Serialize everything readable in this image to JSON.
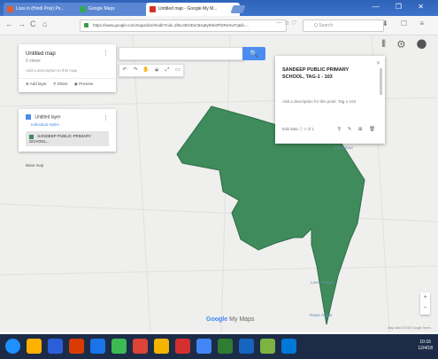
{
  "browser": {
    "tabs": [
      {
        "label": "Loss in (Hindi Poly) Ps...",
        "close": "×",
        "color": "#e25d33"
      },
      {
        "label": "Google Maps",
        "close": "×",
        "color": "#34a853"
      },
      {
        "label": "Untitled map - Google My M...",
        "close": "×",
        "color": "#d93025"
      }
    ],
    "window_controls": "— ❐ ✕",
    "url": "https://www.google.com/maps/d/u/0/edit?mid=1f6sJ4K0Dxr3Hq8y9Xk0Pl2ReXwTq&ll=...",
    "search_placeholder": "Q Search",
    "nav_back": "←",
    "nav_forward": "→",
    "nav_reload": "C",
    "nav_home": "⌂",
    "url_icons": "⋯ ☆ ♡",
    "toolbar_icons": "⬇ ☐ ≡"
  },
  "map": {
    "colors": {
      "polygon": "#3f8b5c",
      "polygon_stroke": "#2f6e48",
      "background": "#efefee",
      "accent": "#4b8cf0"
    },
    "tools": [
      "↶",
      "↷",
      "✋",
      "⬙",
      "⤢",
      "▭"
    ],
    "top_right_icons": "⦀ ⚙ ⬤",
    "search_button": "🔍",
    "labels": [
      {
        "text": "Pandarpur"
      },
      {
        "text": "Laxmi Nagar"
      },
      {
        "text": "Ratan Nagar"
      }
    ],
    "google_logo": "Google",
    "google_suffix": "My Maps",
    "zoom_in": "+",
    "zoom_out": "−",
    "footer": "Map data ©2018 Google  Terms"
  },
  "legend": {
    "title": "Untitled map",
    "views": "0 views",
    "description": "Add a description to this map",
    "actions": [
      "⊕ Add layer",
      "⚲ Share",
      "◉ Preview"
    ],
    "layer_name": "Untitled layer",
    "layer_style": "Individual styles",
    "feature_name": "SANDEEP PUBLIC PRIMARY SCHOOL...",
    "base_map": "Base map",
    "menu_dots": "⋮"
  },
  "popup": {
    "title": "SANDEEP PUBLIC PRIMARY SCHOOL, TAG-1 - 103",
    "description": "Add a description for this point. Tag-1 103",
    "footer": "Edit data  ⓘ 1 of 1",
    "icons": "⚲ ✎ ⊞ 🗑",
    "close": "✕"
  },
  "taskbar": {
    "icons": [
      "#1e90ff",
      "#ffb000",
      "#2b5fd9",
      "#d83b01",
      "#1a73e8",
      "#3cba54",
      "#db4437",
      "#f4b400",
      "#d32f2f",
      "#4285f4",
      "#2e7d32",
      "#1565c0",
      "#7cb342",
      "#0078d7"
    ],
    "time": "10:16",
    "date": "12/4/18"
  }
}
